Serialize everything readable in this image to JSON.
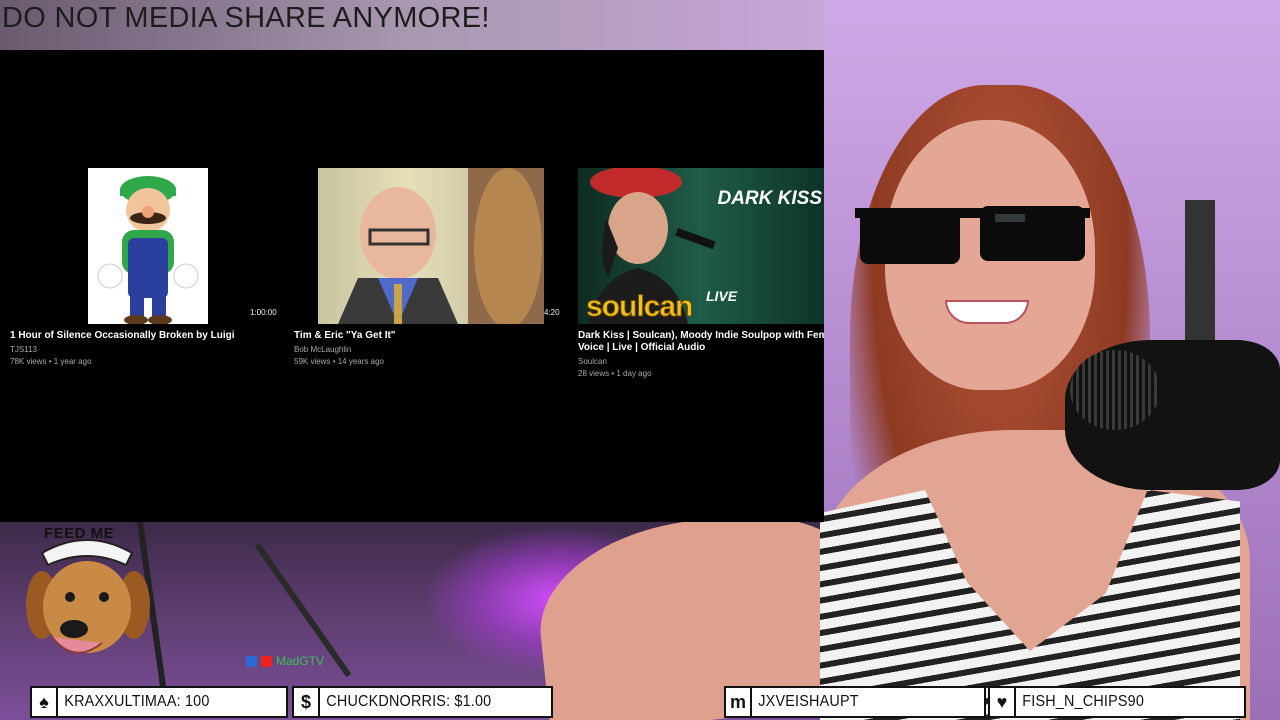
{
  "banner": {
    "text": "DO NOT MEDIA SHARE ANYMORE!"
  },
  "player": {
    "videos": [
      {
        "title": "1 Hour of Silence Occasionally Broken by Luigi",
        "channel": "TJS113",
        "views": "78K views",
        "age": "1 year ago",
        "duration": "1:00:00"
      },
      {
        "title": "Tim & Eric \"Ya Get It\"",
        "channel": "Bob McLaughlin",
        "views": "59K views",
        "age": "14 years ago",
        "duration": "4:20"
      },
      {
        "title": "Dark Kiss | Soulcan), Moody Indie Soulpop with Femal",
        "title_line2": "Voice | Live | Official Audio",
        "channel": "Soulcan",
        "views": "28 views",
        "age": "1 day ago",
        "duration": ""
      }
    ],
    "thumb3_text": "DARK KISS",
    "thumb3_logo": "soulcan",
    "thumb3_live": "LIVE"
  },
  "overlay": {
    "dog_sign": "FEED ME",
    "watermark": "MadGTV"
  },
  "alerts": [
    {
      "icon": "spade-icon",
      "glyph": "♠",
      "text": "KRAXXULTIMAA: 100"
    },
    {
      "icon": "dollar-icon",
      "glyph": "$",
      "text": "CHUCKDNORRIS: $1.00"
    },
    {
      "icon": "m-icon",
      "glyph": "m",
      "text": "JXVEISHAUPT"
    },
    {
      "icon": "heart-icon",
      "glyph": "♥",
      "text": "FISH_N_CHIPS90"
    }
  ],
  "colors": {
    "player_bg": "#000000",
    "alert_bg": "#ffffff",
    "watermark": "#3fbf55"
  }
}
